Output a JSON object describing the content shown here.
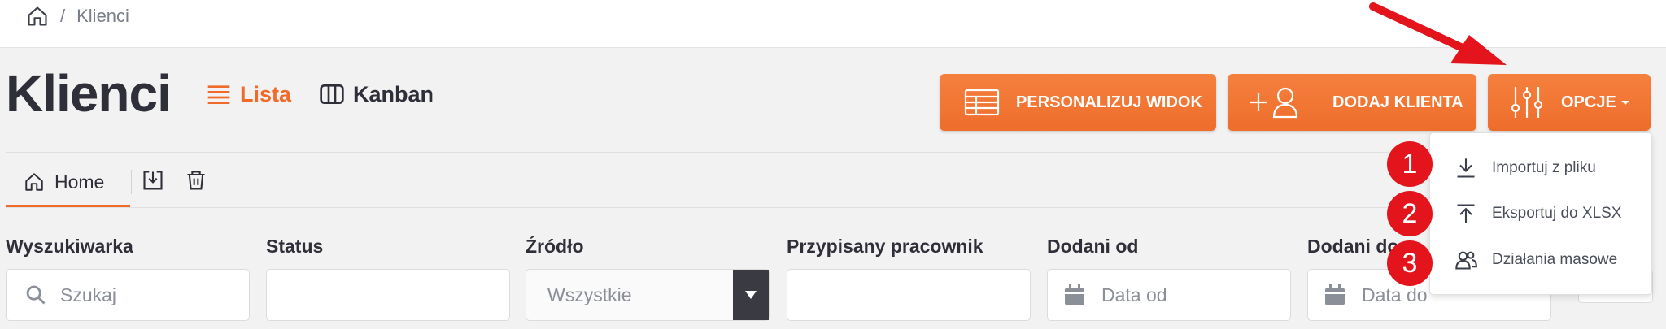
{
  "breadcrumb": {
    "separator": "/",
    "current": "Klienci",
    "home_icon": "home-icon"
  },
  "page": {
    "title": "Klienci"
  },
  "views": [
    {
      "label": "Lista",
      "icon": "list-icon",
      "active": true
    },
    {
      "label": "Kanban",
      "icon": "kanban-icon",
      "active": false
    }
  ],
  "buttons": {
    "customize": {
      "label": "PERSONALIZUJ WIDOK",
      "icon": "table-icon"
    },
    "add_client": {
      "label": "DODAJ KLIENTA",
      "icon": "add-user-icon"
    },
    "options": {
      "label": "OPCJE",
      "icon": "sliders-icon"
    }
  },
  "tabs": {
    "home_label": "Home"
  },
  "filters": {
    "search": {
      "label": "Wyszukiwarka",
      "placeholder": "Szukaj"
    },
    "status": {
      "label": "Status",
      "value": ""
    },
    "source": {
      "label": "Źródło",
      "value": "Wszystkie"
    },
    "employee": {
      "label": "Przypisany pracownik",
      "value": ""
    },
    "added_from": {
      "label": "Dodani od",
      "placeholder": "Data od"
    },
    "added_to": {
      "label": "Dodani do",
      "placeholder": "Data do"
    }
  },
  "options_menu": [
    {
      "badge": "1",
      "label": "Importuj z pliku",
      "icon": "download-icon"
    },
    {
      "badge": "2",
      "label": "Eksportuj do XLSX",
      "icon": "upload-icon"
    },
    {
      "badge": "3",
      "label": "Działania masowe",
      "icon": "users-icon"
    }
  ],
  "colors": {
    "accent": "#f06a2a",
    "badge": "#e3141c",
    "arrow": "#e3141c"
  }
}
